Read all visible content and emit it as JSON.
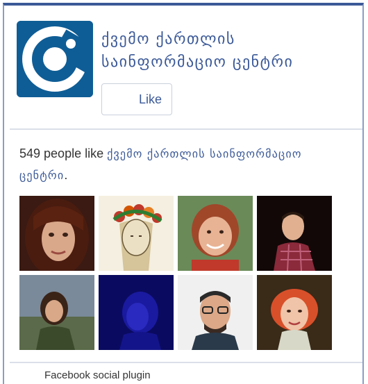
{
  "page": {
    "name": "ქვემო ქართლის საინფორმაციო ცენტრი",
    "logo_icon": "page-logo-icon"
  },
  "like_button": {
    "label": "Like"
  },
  "fans": {
    "count_text": "549 people like ",
    "page_link": "ქვემო ქართლის საინფორმაციო ცენტრი",
    "trailing": ".",
    "avatars": [
      {
        "icon": "avatar-woman-dark-hair-icon"
      },
      {
        "icon": "avatar-flower-crown-drawing-icon"
      },
      {
        "icon": "avatar-woman-smiling-icon"
      },
      {
        "icon": "avatar-man-plaid-shirt-icon"
      },
      {
        "icon": "avatar-woman-outdoors-icon"
      },
      {
        "icon": "avatar-blue-tinted-person-icon"
      },
      {
        "icon": "avatar-man-glasses-icon"
      },
      {
        "icon": "avatar-woman-red-hair-icon"
      }
    ]
  },
  "footer": {
    "text": "Facebook social plugin"
  },
  "colors": {
    "facebook_blue": "#3b5998",
    "border": "#8b9dc3",
    "logo_blue": "#0f5d96"
  }
}
